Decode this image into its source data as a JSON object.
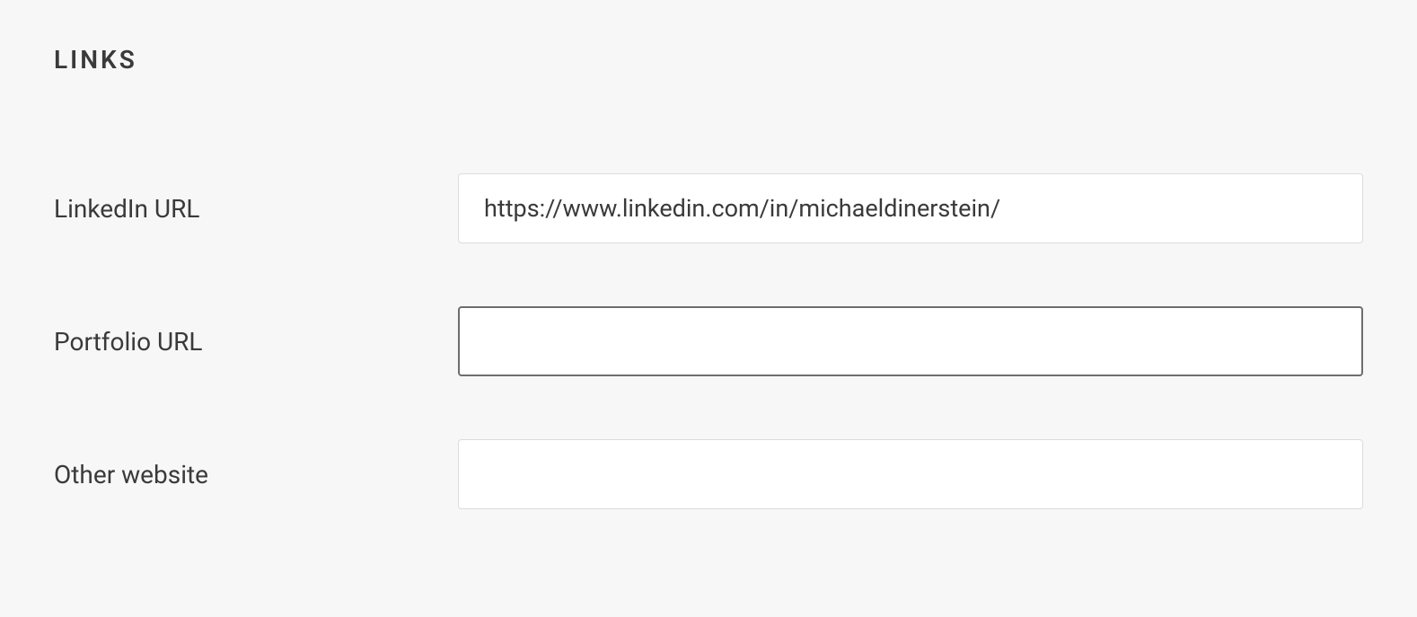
{
  "section": {
    "title": "LINKS"
  },
  "fields": {
    "linkedin": {
      "label": "LinkedIn URL",
      "value": "https://www.linkedin.com/in/michaeldinerstein/"
    },
    "portfolio": {
      "label": "Portfolio URL",
      "value": ""
    },
    "other": {
      "label": "Other website",
      "value": ""
    }
  }
}
